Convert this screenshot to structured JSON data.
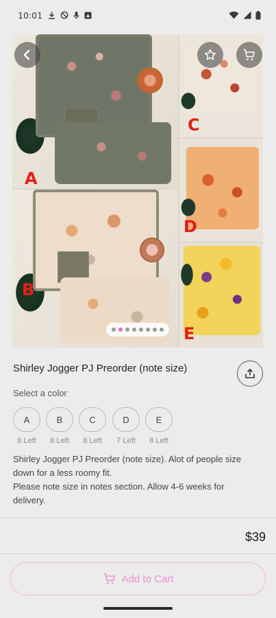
{
  "status_bar": {
    "time": "10:01",
    "left_icons": [
      "download-icon",
      "dnd-icon",
      "mic-icon",
      "app-icon"
    ],
    "right_icons": [
      "wifi-icon",
      "signal-icon",
      "battery-icon"
    ]
  },
  "gallery": {
    "panel_letters": [
      "A",
      "B",
      "C",
      "D",
      "E"
    ],
    "image_count": 8,
    "active_index": 1,
    "colors": {
      "letter": "#e0201a",
      "dot_active": "#e070c0"
    }
  },
  "product": {
    "title": "Shirley Jogger PJ Preorder (note size)",
    "select_color_label": "Select a color",
    "colors": [
      {
        "label": "A",
        "stock": "8 Left"
      },
      {
        "label": "B",
        "stock": "8 Left"
      },
      {
        "label": "C",
        "stock": "8 Left"
      },
      {
        "label": "D",
        "stock": "7 Left"
      },
      {
        "label": "E",
        "stock": "8 Left"
      }
    ],
    "description_lines": [
      "Shirley Jogger PJ Preorder (note size). Alot of people size",
      "down for a less roomy fit.",
      "Please note size in notes section. Allow 4-6 weeks for",
      "delivery."
    ],
    "price": "$39"
  },
  "cart": {
    "add_label": "Add to Cart",
    "accent": "#ef8ed2"
  }
}
